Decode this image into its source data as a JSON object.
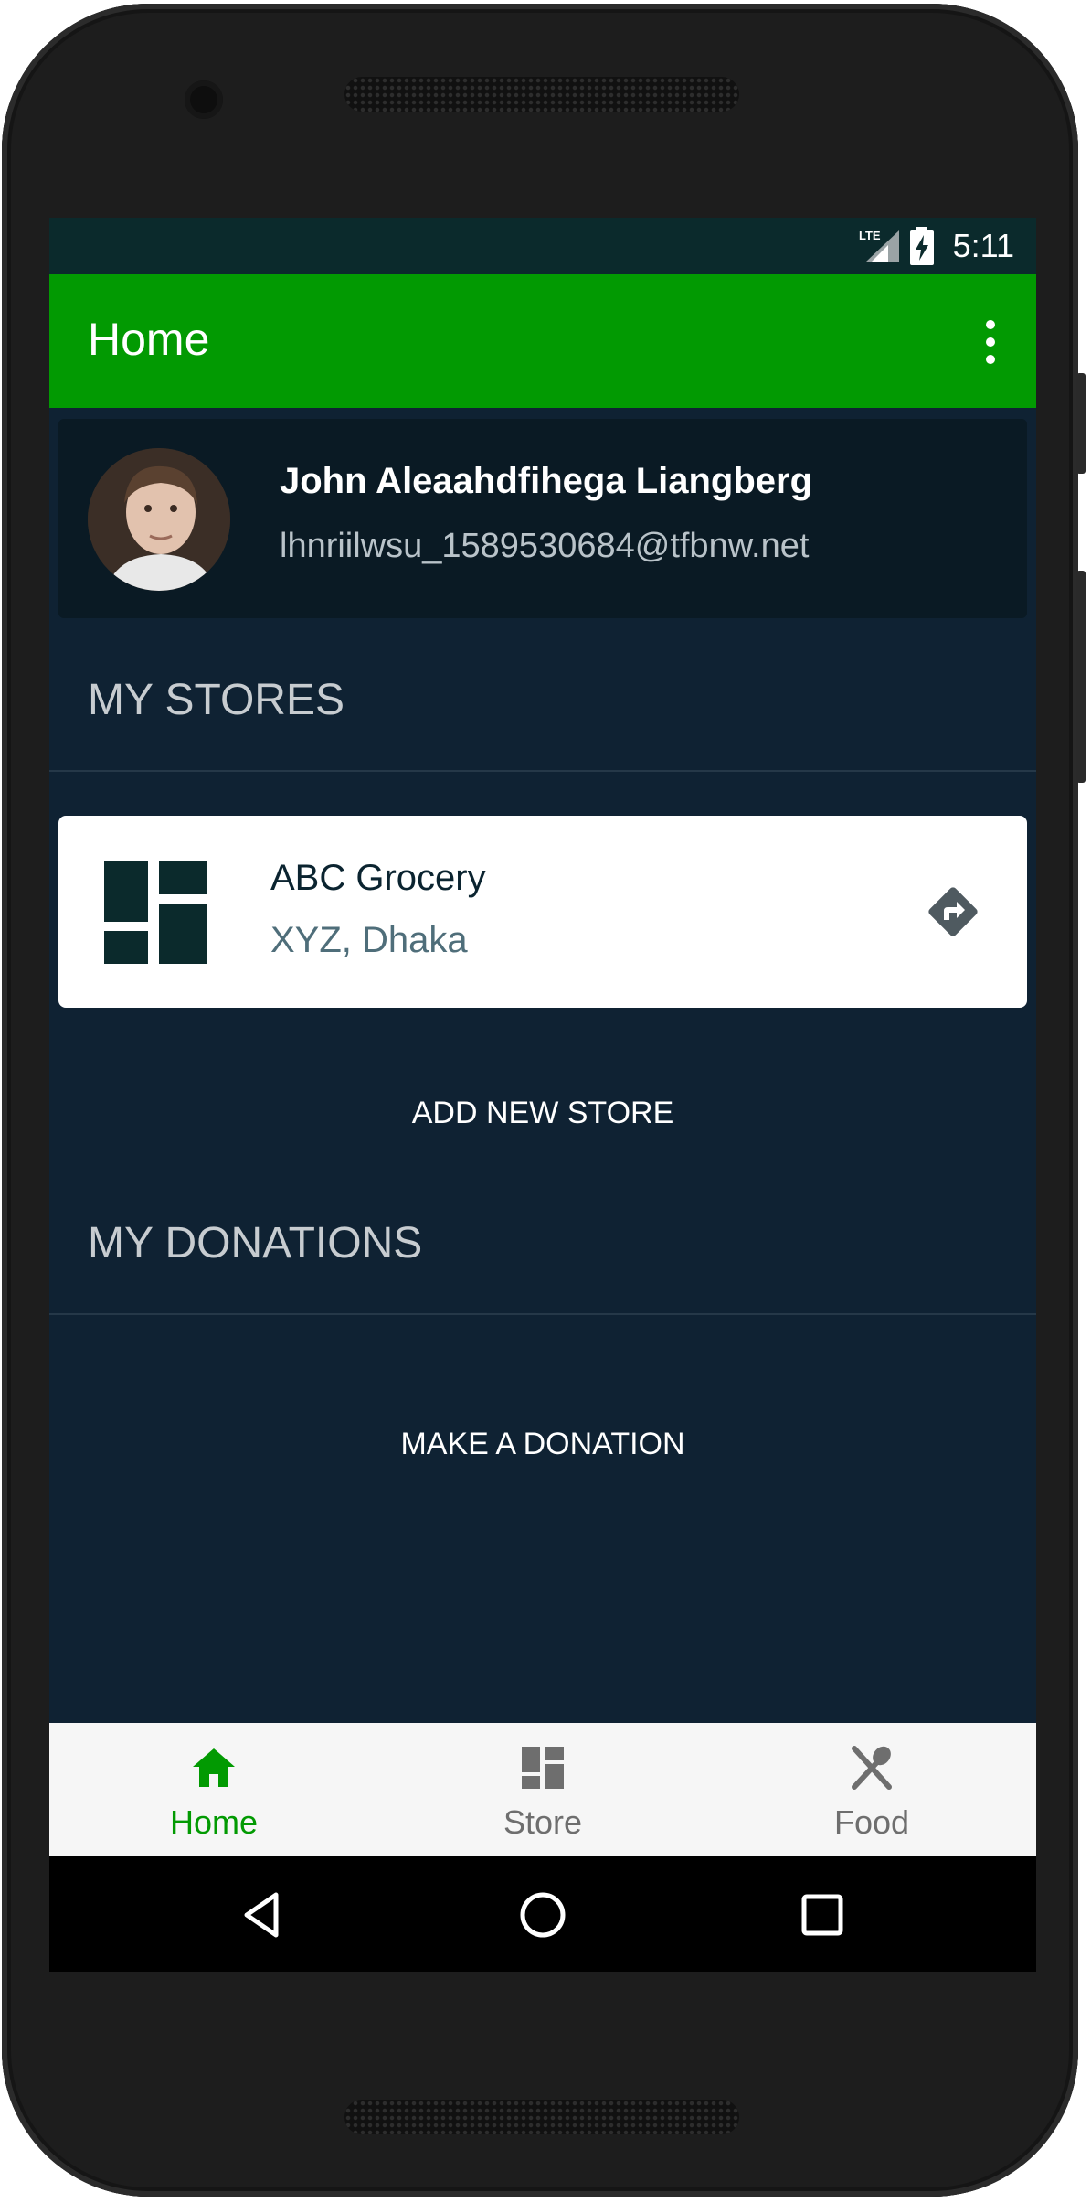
{
  "status_bar": {
    "time": "5:11",
    "network": "LTE",
    "icons": [
      "lte-signal-icon",
      "battery-charging-icon"
    ]
  },
  "app_bar": {
    "title": "Home",
    "menu_icon": "overflow-menu-icon",
    "color": "#029a02"
  },
  "profile": {
    "name": "John Aleaahdfihega Liangberg",
    "email": "lhnriilwsu_1589530684@tfbnw.net"
  },
  "stores": {
    "title": "MY STORES",
    "items": [
      {
        "name": "ABC Grocery",
        "address": "XYZ, Dhaka",
        "icon": "store-dashboard-icon",
        "action_icon": "directions-icon"
      }
    ],
    "add_label": "ADD NEW STORE"
  },
  "donations": {
    "title": "MY DONATIONS",
    "make_label": "MAKE A DONATION"
  },
  "bottom_nav": {
    "items": [
      {
        "label": "Home",
        "icon": "home-icon",
        "active": true
      },
      {
        "label": "Store",
        "icon": "store-icon",
        "active": false
      },
      {
        "label": "Food",
        "icon": "food-icon",
        "active": false
      }
    ],
    "active_color": "#029a02",
    "inactive_color": "#6e6e6e"
  },
  "system_nav": {
    "icons": [
      "back-icon",
      "home-circle-icon",
      "recents-icon"
    ]
  },
  "colors": {
    "background": "#0f2233",
    "card": "#ffffff",
    "status_bar": "#0b2a2c"
  }
}
